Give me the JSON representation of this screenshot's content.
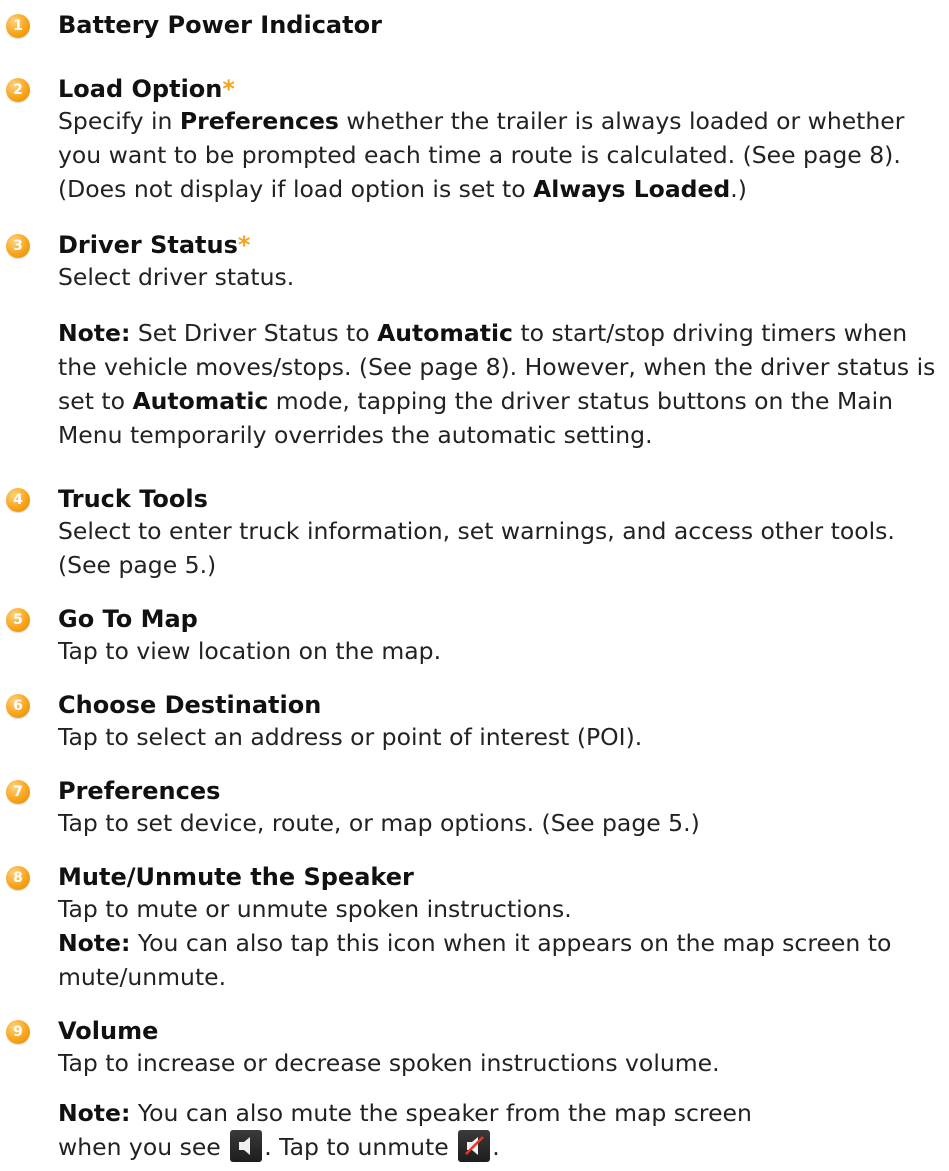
{
  "items": [
    {
      "number": "1",
      "title": "Battery Power Indicator"
    },
    {
      "number": "2",
      "title": "Load Option",
      "star": "*",
      "desc_parts": [
        "Specify in ",
        "Preferences",
        " whether the trailer is always loaded or whether you want to be prompted each time a route is calculated. (See page 8). (Does not display if load option is set to ",
        "Always Loaded",
        ".)"
      ]
    },
    {
      "number": "3",
      "title": "Driver Status",
      "star": "*",
      "desc": "Select driver status.",
      "note_label": "Note:",
      "note_parts": [
        " Set Driver Status to ",
        "Automatic",
        " to start/stop driving timers when the vehicle moves/stops. (See page 8). However, when the driver status is set to ",
        "Automatic",
        " mode, tapping the driver status buttons on the Main Menu temporarily overrides the automatic setting."
      ]
    },
    {
      "number": "4",
      "title": "Truck Tools",
      "desc": "Select to enter truck information, set warnings, and access other tools. (See page 5.)"
    },
    {
      "number": "5",
      "title": "Go To Map",
      "desc": "Tap to view location on the map."
    },
    {
      "number": "6",
      "title": "Choose Destination",
      "desc": "Tap to select an address or point of interest (POI)."
    },
    {
      "number": "7",
      "title": "Preferences",
      "desc": "Tap to set device, route, or map options. (See page 5.)"
    },
    {
      "number": "8",
      "title": "Mute/Unmute the Speaker",
      "desc": "Tap to mute or unmute spoken instructions.",
      "note_label": "Note:",
      "note": " You can also tap this icon when it appears on the map screen to mute/unmute."
    },
    {
      "number": "9",
      "title": "Volume",
      "desc": "Tap to increase or decrease spoken instructions volume.",
      "note_label": "Note:",
      "note_line1": " You can also mute the speaker from the map screen",
      "note_line2_a": "when you see ",
      "note_line2_b": ". Tap to unmute ",
      "note_line2_c": "."
    }
  ],
  "colors": {
    "badge": "#f7a41c",
    "star": "#f4a21d",
    "text": "#222222"
  },
  "icons": {
    "speaker": "speaker-icon",
    "speaker_muted": "speaker-muted-icon"
  }
}
